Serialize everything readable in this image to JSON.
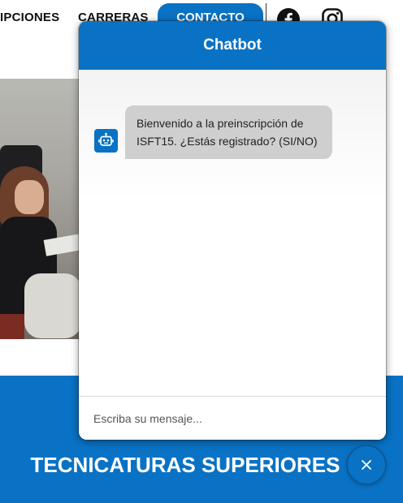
{
  "nav": {
    "items": [
      "IPCIONES",
      "CARRERAS"
    ],
    "contact_label": "CONTACTO",
    "social": [
      "facebook-icon",
      "instagram-icon"
    ]
  },
  "chatbot": {
    "title": "Chatbot",
    "messages": [
      {
        "sender": "bot",
        "text": "Bienvenido a la preinscripción de ISFT15. ¿Estás registrado? (SI/NO)"
      }
    ],
    "input_placeholder": "Escriba su mensaje...",
    "close_icon": "close-icon"
  },
  "band": {
    "title": "TECNICATURAS SUPERIORES"
  },
  "colors": {
    "accent": "#0972c4",
    "bubble": "#cfcfcf"
  }
}
